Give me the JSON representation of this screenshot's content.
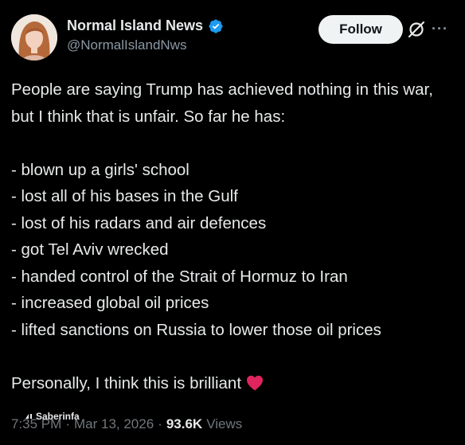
{
  "author": {
    "display_name": "Normal Island News",
    "handle": "@NormalIslandNws"
  },
  "actions": {
    "follow_label": "Follow",
    "more_label": "···"
  },
  "tweet": {
    "intro": "People are saying Trump has achieved nothing in this war, but I think that is unfair. So far he has:",
    "items": [
      "- blown up a girls' school",
      "- lost all of his bases in the Gulf",
      "- lost of his radars and air defences",
      "- got Tel Aviv wrecked",
      "- handed control of the Strait of Hormuz to Iran",
      "- increased global oil prices",
      "- lifted sanctions on Russia to lower those oil prices"
    ],
    "closing": "Personally, I think this is brilliant"
  },
  "meta": {
    "time": "7:35 PM",
    "separator": "·",
    "date": "Mar 13, 2026",
    "views_count": "93.6K",
    "views_label": "Views"
  },
  "watermark": {
    "text": "Saberinfa"
  },
  "icons": {
    "verified": "verified-badge-icon",
    "grok": "grok-icon",
    "heart": "red-heart-emoji-icon",
    "more": "more-options-icon"
  },
  "colors": {
    "background": "#000000",
    "text": "#e7e9ea",
    "secondary": "#71767b",
    "verified": "#1d9bf0",
    "follow_bg": "#eff3f4",
    "heart": "#e0245e"
  }
}
